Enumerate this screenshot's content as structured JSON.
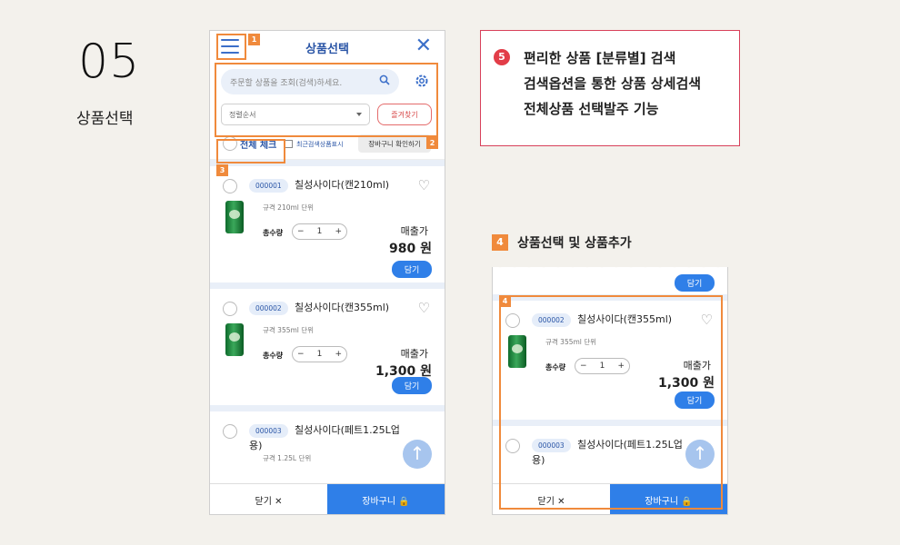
{
  "step": {
    "number": "05",
    "title": "상품선택"
  },
  "phone": {
    "header": {
      "title": "상품선택"
    },
    "search": {
      "placeholder": "주문할 상품을 조회(검색)하세요.",
      "sort": "정렬순서",
      "favorites": "즐겨찾기"
    },
    "check_row": {
      "all": "전체 체크",
      "recent": "최근검색상품표시",
      "cart_check": "장바구니 확인하기"
    },
    "items": [
      {
        "code": "000001",
        "name": "칠성사이다(캔210ml)",
        "spec": "규격 210ml   단위",
        "qty_label": "총수량",
        "qty": "1",
        "price_label": "매출가",
        "price": "980 원",
        "add": "담기"
      },
      {
        "code": "000002",
        "name": "칠성사이다(캔355ml)",
        "spec": "규격 355ml   단위",
        "qty_label": "총수량",
        "qty": "1",
        "price_label": "매출가",
        "price": "1,300 원",
        "add": "담기"
      },
      {
        "code": "000003",
        "name": "칠성사이다(페트1.25L업",
        "name2": "용)",
        "spec": "규격 1.25L   단위"
      }
    ],
    "bottom": {
      "close": "닫기 ✕",
      "cart": "장바구니 🔒"
    }
  },
  "annotations": {
    "tag1": "1",
    "tag2": "2",
    "tag3": "3",
    "tag4": "4"
  },
  "note": {
    "badge": "5",
    "lines": [
      "편리한 상품 [분류별] 검색",
      "검색옵션을 통한 상품 상세검색",
      "전체상품 선택발주 기능"
    ]
  },
  "section4": {
    "num": "4",
    "title": "상품선택 및 상품추가"
  },
  "colors": {
    "accent": "#2f7fe8",
    "annotation": "#f08a3c",
    "note_border": "#d8405a"
  }
}
